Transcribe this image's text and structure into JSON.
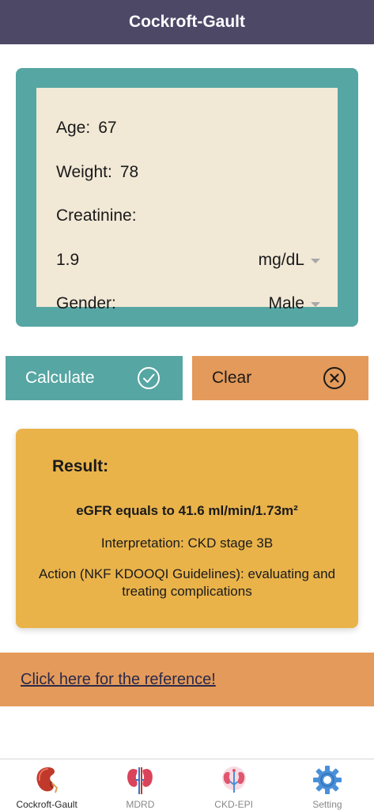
{
  "header": {
    "title": "Cockroft-Gault"
  },
  "inputs": {
    "age_label": "Age:",
    "age_value": "67",
    "weight_label": "Weight:",
    "weight_value": "78",
    "creatinine_label": "Creatinine:",
    "creatinine_value": "1.9",
    "creatinine_unit": "mg/dL",
    "gender_label": "Gender:",
    "gender_value": "Male"
  },
  "buttons": {
    "calculate_label": "Calculate",
    "clear_label": "Clear"
  },
  "result": {
    "title": "Result:",
    "egfr": "eGFR equals to 41.6 ml/min/1.73m²",
    "interpretation": "Interpretation: CKD stage 3B",
    "action": "Action (NKF KDOOQI Guidelines): evaluating and treating complications"
  },
  "reference": {
    "link_text": "Click here for the reference!"
  },
  "tabs": [
    {
      "label": "Cockroft-Gault",
      "icon": "kidney-icon",
      "active": true
    },
    {
      "label": "MDRD",
      "icon": "kidneys-icon",
      "active": false
    },
    {
      "label": "CKD-EPI",
      "icon": "kidney-network-icon",
      "active": false
    },
    {
      "label": "Setting",
      "icon": "gear-icon",
      "active": false
    }
  ],
  "colors": {
    "header_bg": "#4e4867",
    "teal": "#56a6a3",
    "cream": "#f1e8d6",
    "orange": "#e49a5a",
    "result_bg": "#e9b34a"
  }
}
